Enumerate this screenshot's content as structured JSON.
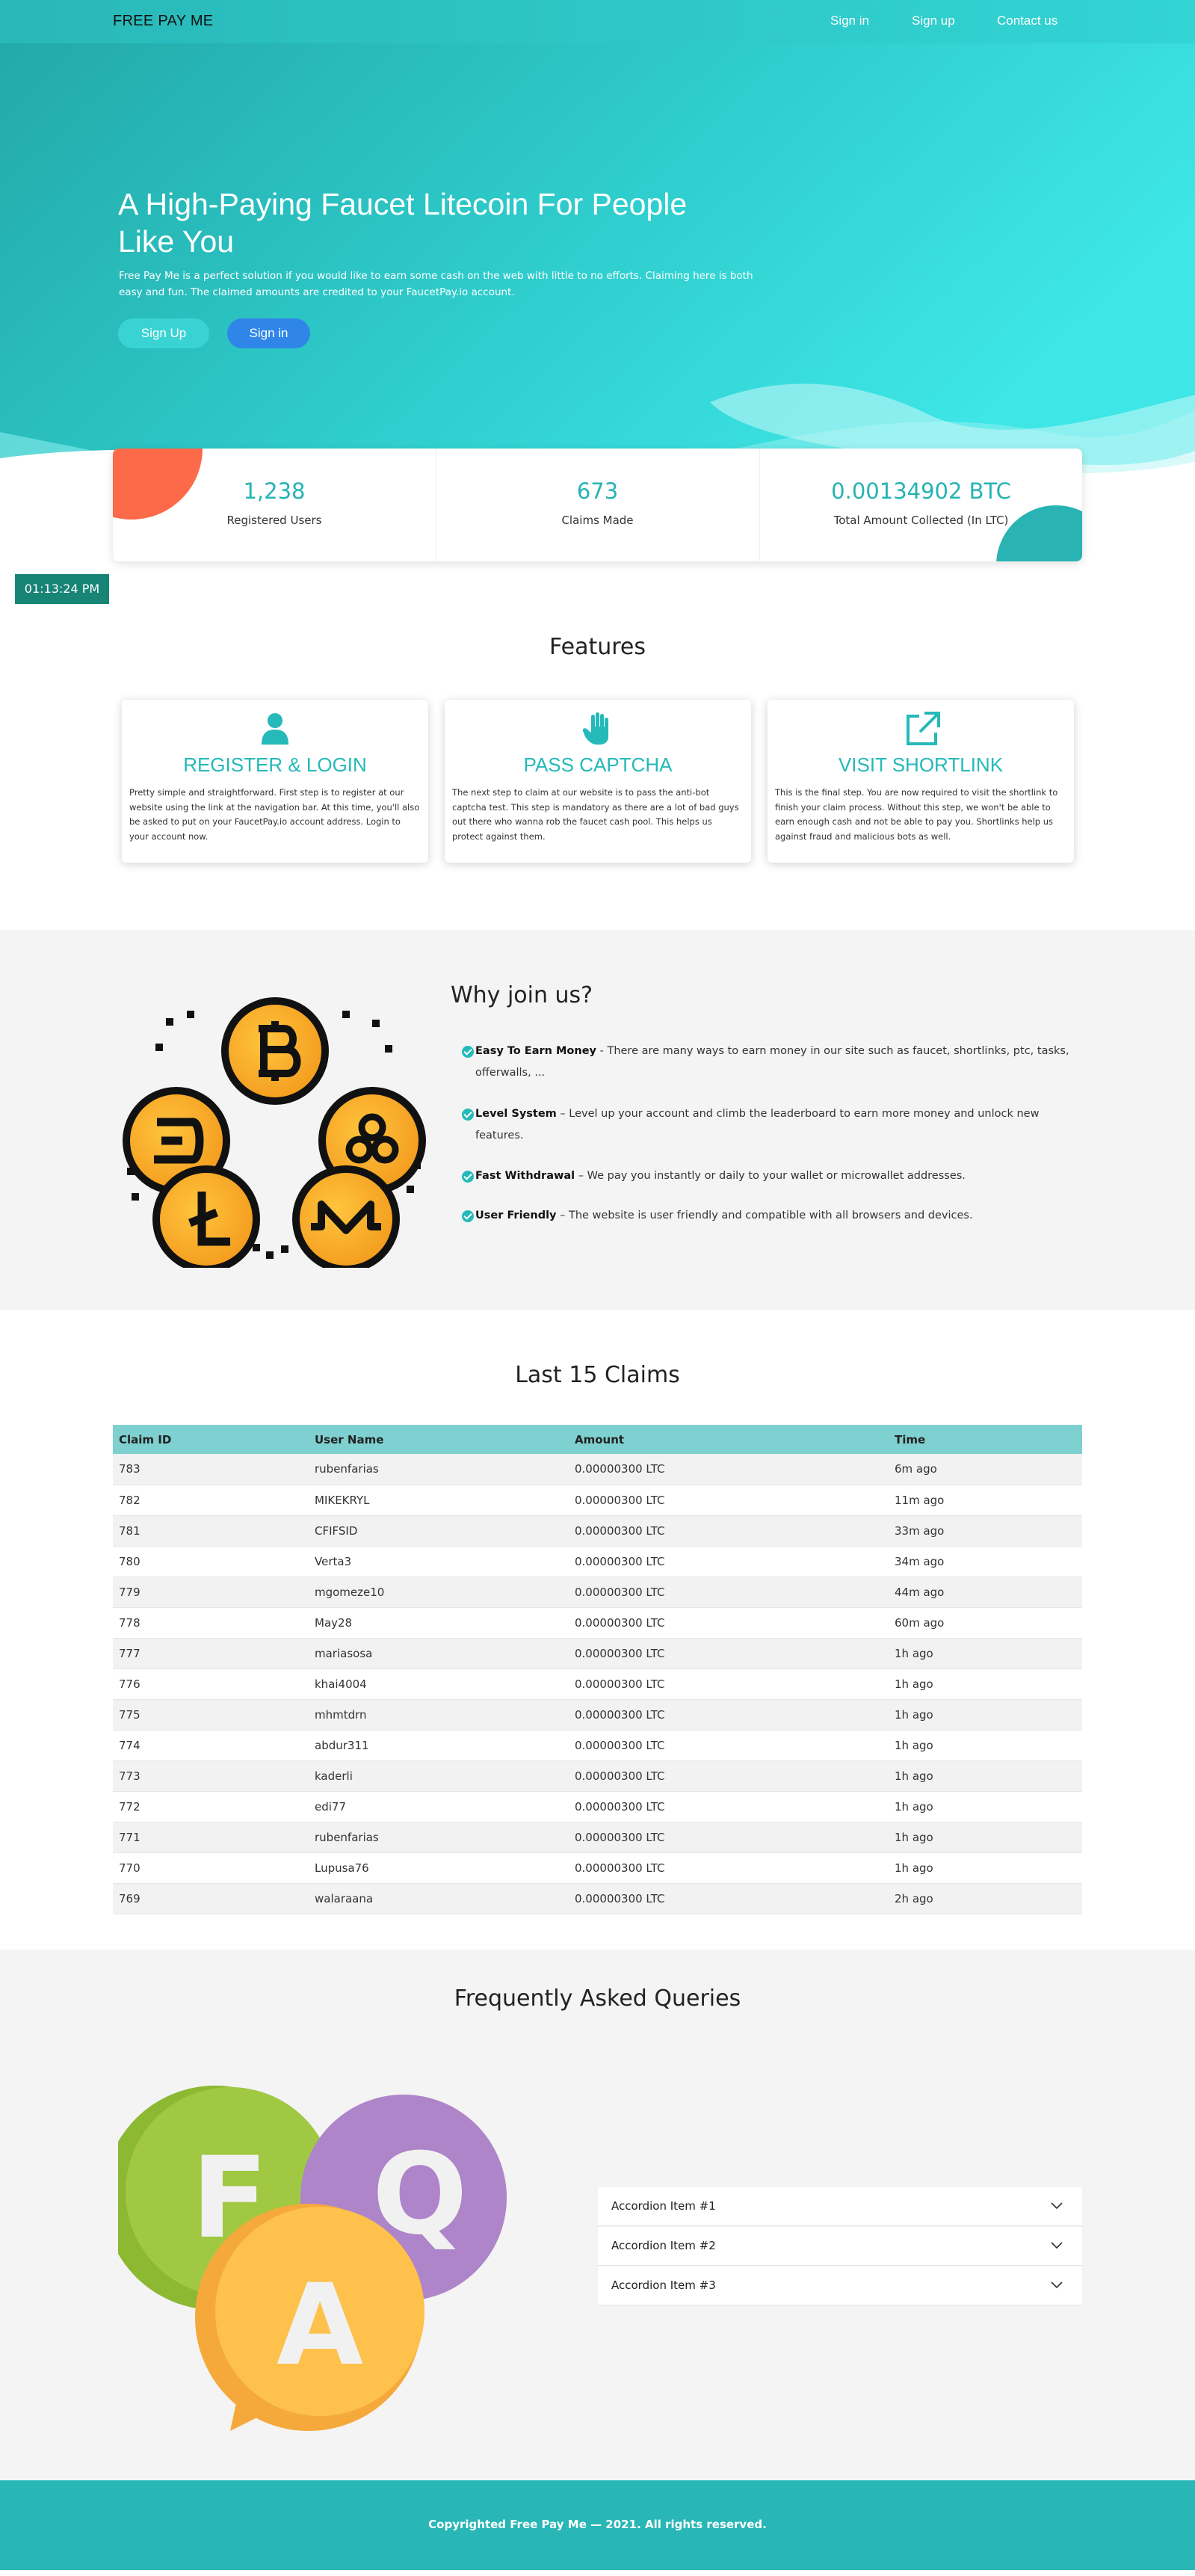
{
  "nav": {
    "brand": "FREE PAY ME",
    "links": [
      "Sign in",
      "Sign up",
      "Contact us"
    ]
  },
  "hero": {
    "title": "A High-Paying Faucet Litecoin For People Like You",
    "subtitle": "Free Pay Me is a perfect solution if you would like to earn some cash on the web with little to no efforts. Claiming here is both easy and fun. The claimed amounts are credited to your FaucetPay.io account.",
    "signup_label": "Sign Up",
    "signin_label": "Sign in"
  },
  "stats": [
    {
      "value": "1,238",
      "label": "Registered Users"
    },
    {
      "value": "673",
      "label": "Claims Made"
    },
    {
      "value": "0.00134902 BTC",
      "label": "Total Amount Collected (In LTC)"
    }
  ],
  "clock": "01:13:24 PM",
  "features": {
    "title": "Features",
    "cards": [
      {
        "icon": "user-icon",
        "title": "REGISTER & LOGIN",
        "text": "Pretty simple and straightforward. First step is to register at our website using the link at the navigation bar. At this time, you'll also be asked to put on your FaucetPay.io account address. Login to your account now."
      },
      {
        "icon": "hand-icon",
        "title": "PASS CAPTCHA",
        "text": "The next step to claim at our website is to pass the anti-bot captcha test. This step is mandatory as there are a lot of bad guys out there who wanna rob the faucet cash pool. This helps us protect against them."
      },
      {
        "icon": "external-link-icon",
        "title": "VISIT SHORTLINK",
        "text": "This is the final step. You are now required to visit the shortlink to finish your claim process. Without this step, we won't be able to earn enough cash and not be able to pay you. Shortlinks help us against fraud and malicious bots as well."
      }
    ]
  },
  "why": {
    "title": "Why join us?",
    "items": [
      {
        "bold": "Easy To Earn Money",
        "text": " - There are many ways to earn money in our site such as faucet, shortlinks, ptc, tasks, offerwalls, ..."
      },
      {
        "bold": "Level System",
        "text": " – Level up your account and climb the leaderboard to earn more money and unlock new features."
      },
      {
        "bold": "Fast Withdrawal",
        "text": " – We pay you instantly or daily to your wallet or microwallet addresses."
      },
      {
        "bold": "User Friendly",
        "text": " – The website is user friendly and compatible with all browsers and devices."
      }
    ]
  },
  "claims": {
    "title": "Last 15 Claims",
    "headers": [
      "Claim ID",
      "User Name",
      "Amount",
      "Time"
    ],
    "rows": [
      [
        "783",
        "rubenfarias",
        "0.00000300 LTC",
        "6m ago"
      ],
      [
        "782",
        "MIKEKRYL",
        "0.00000300 LTC",
        "11m ago"
      ],
      [
        "781",
        "CFIFSID",
        "0.00000300 LTC",
        "33m ago"
      ],
      [
        "780",
        "Verta3",
        "0.00000300 LTC",
        "34m ago"
      ],
      [
        "779",
        "mgomeze10",
        "0.00000300 LTC",
        "44m ago"
      ],
      [
        "778",
        "May28",
        "0.00000300 LTC",
        "60m ago"
      ],
      [
        "777",
        "mariasosa",
        "0.00000300 LTC",
        "1h ago"
      ],
      [
        "776",
        "khai4004",
        "0.00000300 LTC",
        "1h ago"
      ],
      [
        "775",
        "mhmtdrn",
        "0.00000300 LTC",
        "1h ago"
      ],
      [
        "774",
        "abdur311",
        "0.00000300 LTC",
        "1h ago"
      ],
      [
        "773",
        "kaderli",
        "0.00000300 LTC",
        "1h ago"
      ],
      [
        "772",
        "edi77",
        "0.00000300 LTC",
        "1h ago"
      ],
      [
        "771",
        "rubenfarias",
        "0.00000300 LTC",
        "1h ago"
      ],
      [
        "770",
        "Lupusa76",
        "0.00000300 LTC",
        "1h ago"
      ],
      [
        "769",
        "walaraana",
        "0.00000300 LTC",
        "2h ago"
      ]
    ]
  },
  "faq": {
    "title": "Frequently Asked Queries",
    "letters": [
      "F",
      "Q",
      "A"
    ],
    "items": [
      "Accordion Item #1",
      "Accordion Item #2",
      "Accordion Item #3"
    ]
  },
  "footer": {
    "text": "Copyrighted Free Pay Me — 2021. All rights reserved."
  },
  "colors": {
    "accent": "#29b8b8",
    "primary_button": "#2f86e8",
    "orange": "#fd6a4a",
    "clock_bg": "#178476"
  }
}
